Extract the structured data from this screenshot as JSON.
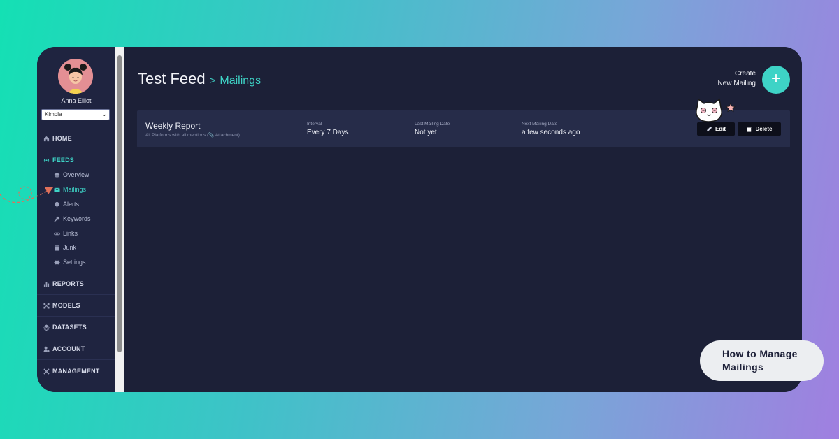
{
  "sidebar": {
    "user_name": "Anna Elliot",
    "org_selected": "Kimola",
    "nav": {
      "home": "HOME",
      "feeds": "FEEDS",
      "reports": "REPORTS",
      "models": "MODELS",
      "datasets": "DATASETS",
      "account": "ACCOUNT",
      "management": "MANAGEMENT"
    },
    "feeds_sub": {
      "overview": "Overview",
      "mailings": "Mailings",
      "alerts": "Alerts",
      "keywords": "Keywords",
      "links": "Links",
      "junk": "Junk",
      "settings": "Settings"
    }
  },
  "header": {
    "breadcrumb_root": "Test Feed",
    "breadcrumb_sep": ">",
    "breadcrumb_leaf": "Mailings",
    "create_line1": "Create",
    "create_line2": "New Mailing",
    "create_icon": "+"
  },
  "mailing": {
    "title": "Weekly Report",
    "subtitle": "All Platforms with all mentions (📎 Attachment)",
    "interval_label": "Interval",
    "interval_value": "Every 7 Days",
    "last_label": "Last Mailing Date",
    "last_value": "Not yet",
    "next_label": "Next Mailing Date",
    "next_value": "a few seconds ago",
    "edit_label": "Edit",
    "delete_label": "Delete"
  },
  "cta": {
    "line1": "How to Manage",
    "line2": "Mailings"
  },
  "colors": {
    "accent": "#3ed3c6",
    "panel": "#1c2037",
    "sidebar": "#1f2440"
  }
}
